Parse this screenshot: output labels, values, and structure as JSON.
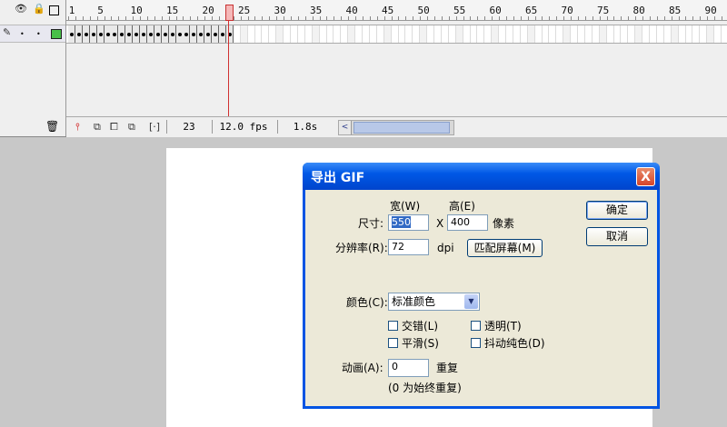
{
  "timeline": {
    "ruler_numbers": [
      "1",
      "5",
      "10",
      "15",
      "20",
      "25",
      "30",
      "35",
      "40",
      "45",
      "50",
      "55",
      "60",
      "65",
      "70",
      "75",
      "80",
      "85",
      "90"
    ],
    "current_frame": "23",
    "fps": "12.0 fps",
    "elapsed": "1.8s",
    "keyframe_count": 23,
    "scroll_left_arrow": "<",
    "playhead_frame": 23
  },
  "dialog": {
    "title": "导出 GIF",
    "close_glyph": "X",
    "width_label": "宽(W)",
    "height_label": "高(E)",
    "size_label": "尺寸:",
    "width_value": "550",
    "x_sep": "X",
    "height_value": "400",
    "pixels_label": "像素",
    "resolution_label": "分辨率(R):",
    "resolution_value": "72",
    "dpi_label": "dpi",
    "match_screen_button": "匹配屏幕(M)",
    "ok_button": "确定",
    "cancel_button": "取消",
    "colors_label": "颜色(C):",
    "colors_selected": "标准颜色",
    "interlace_label": "交错(L)",
    "smooth_label": "平滑(S)",
    "transparent_label": "透明(T)",
    "dither_label": "抖动纯色(D)",
    "animation_label": "动画(A):",
    "animation_value": "0",
    "repeat_label": "重复",
    "repeat_hint": "(0 为始终重复)"
  }
}
